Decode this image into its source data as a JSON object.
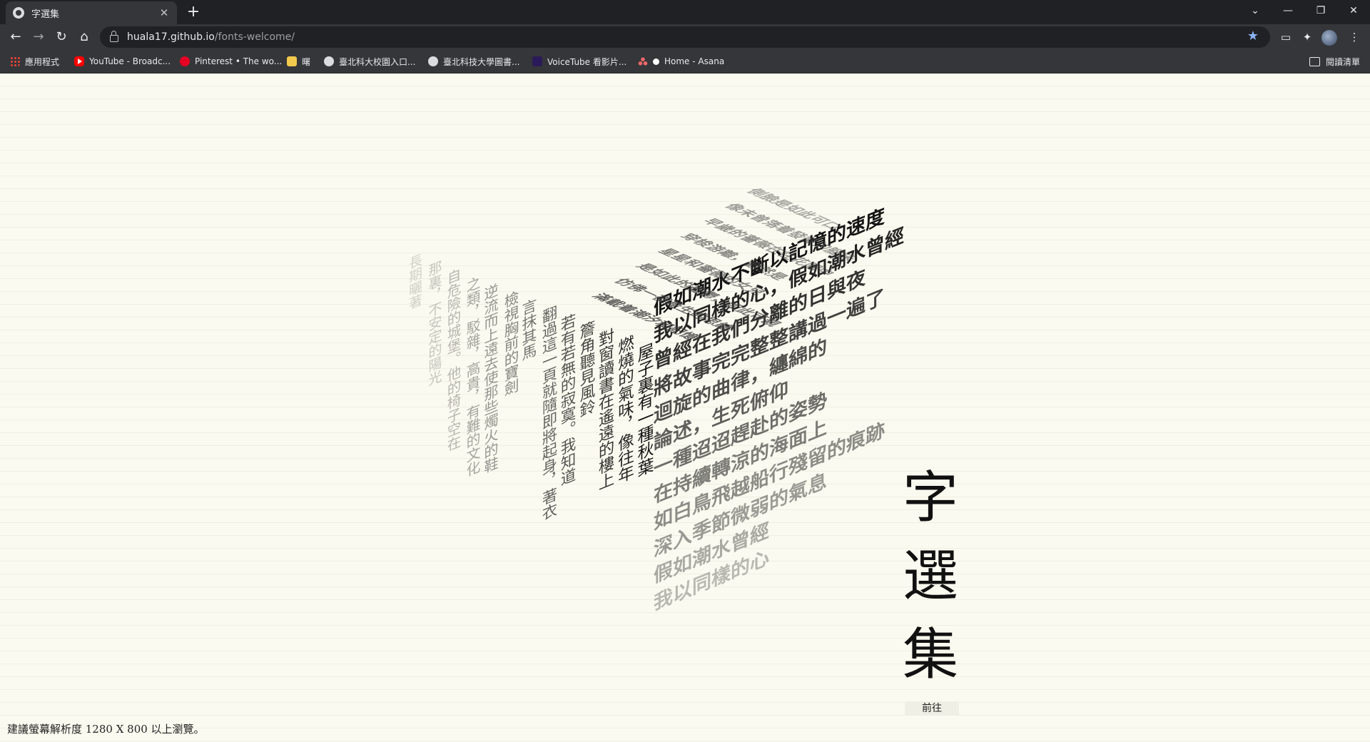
{
  "browser": {
    "tab_title": "字選集",
    "url_host": "huala17.github.io",
    "url_path": "/fonts-welcome/",
    "bookmarks": [
      {
        "label": "應用程式",
        "icon": "apps-icon"
      },
      {
        "label": "YouTube - Broadc...",
        "icon": "youtube-icon"
      },
      {
        "label": "Pinterest • The wo...",
        "icon": "pinterest-icon"
      },
      {
        "label": "曙",
        "icon": "folder-icon"
      },
      {
        "label": "臺北科大校園入口...",
        "icon": "globe-icon"
      },
      {
        "label": "臺北科技大學圖書...",
        "icon": "globe-icon"
      },
      {
        "label": "VoiceTube 看影片...",
        "icon": "voicetube-icon"
      },
      {
        "label": "Home - Asana",
        "icon": "asana-icon"
      }
    ],
    "reading_list": "閱讀清單"
  },
  "cube": {
    "left_face": [
      "屋子裏有一種秋葉",
      "燃燒的氣味，像往年",
      "對窗讀書在遙遠的樓上",
      "簷角聽見風鈴",
      "若有若無的寂寞。我知道",
      "翻過這一頁就隨即將起身，著衣",
      "言抹其馬",
      "檢視胸前的寶劍",
      "逆流而上遠去使那些燭火的鞋",
      "之類，駁雜，高貴，有難的文化",
      "自危險的城堡。他的椅子空在",
      "那裏，不安定的陽光",
      "長期曬著"
    ],
    "right_face": [
      "假如潮水不斷以記憶的速度",
      "我以同樣的心，假如潮水曾經",
      "曾經在我們分離的日與夜",
      "將故事完完整整講過一遍了",
      "迴旋的曲律，纏綿的",
      "論述，生死俯仰",
      "一種迢迢趕赴的姿勢",
      "在持續轉涼的海面上",
      "如白鳥飛越船行殘留的痕跡",
      "深入季節微弱的氣息",
      "假如潮水曾經",
      "我以同樣的心"
    ],
    "top_face": [
      "側臉是如此可口",
      "像未曾落着發黴的腳床",
      "早歲的薔薇在往花園中",
      "穿梭游離，鬱然是",
      "星星和薔薇的女兒",
      "是如此的憂鬱，如此可親",
      "仿佛一夜產生的思緒",
      "滿載着潮汐和記憶"
    ]
  },
  "brand": {
    "chars": [
      "字",
      "選",
      "集"
    ],
    "cta": "前往"
  },
  "footer_note": "建議螢幕解析度 1280 X 800 以上瀏覽。"
}
